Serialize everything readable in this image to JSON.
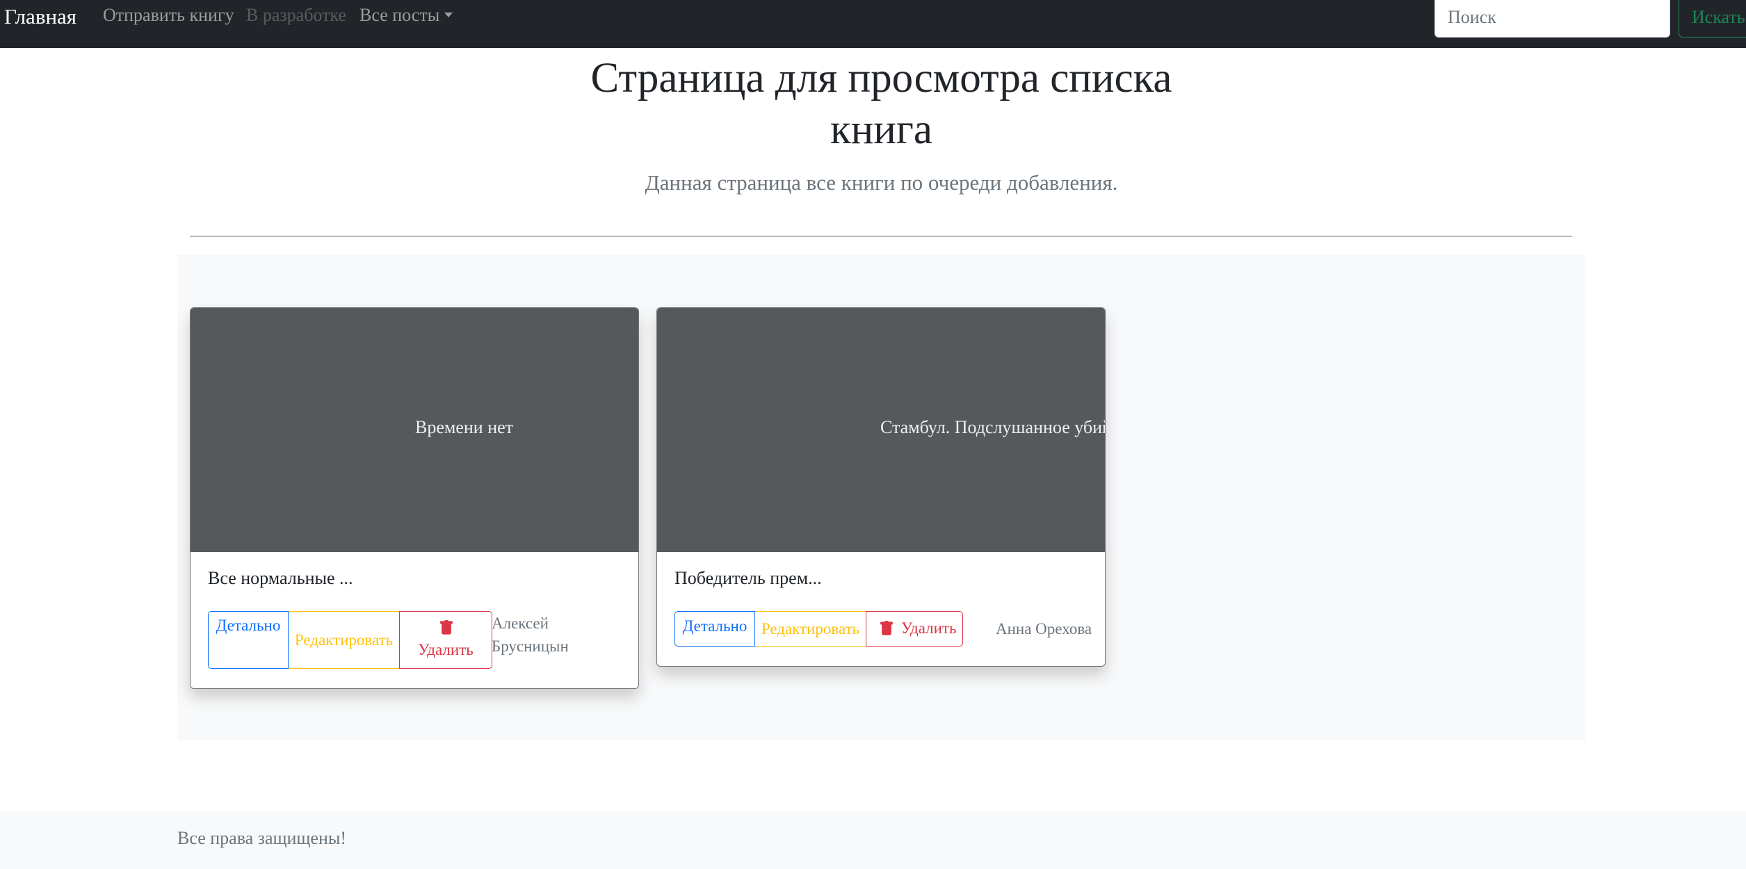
{
  "navbar": {
    "brand": "Главная",
    "links": {
      "submit": "Отправить книгу",
      "dev": "В разработке",
      "posts": "Все посты"
    },
    "search": {
      "placeholder": "Поиск",
      "button": "Искать"
    }
  },
  "header": {
    "title": "Страница для просмотра списка книга",
    "subtitle": "Данная страница все книги по очереди добавления."
  },
  "cards": [
    {
      "thumb_title": "Времени нет",
      "text": "Все нормальные ...",
      "buttons": {
        "detail": "Детально",
        "edit": "Редактировать",
        "delete": "Удалить"
      },
      "author": "Алексей Брусницын"
    },
    {
      "thumb_title": "Стамбул. Подслушанное убийство",
      "text": "Победитель прем...",
      "buttons": {
        "detail": "Детально",
        "edit": "Редактировать",
        "delete": "Удалить"
      },
      "author": "Анна Орехова"
    }
  ],
  "footer": {
    "text": "Все права защищены!"
  },
  "colors": {
    "navbar_bg": "#212529",
    "primary": "#0d6efd",
    "warning": "#ffc107",
    "danger": "#dc3545",
    "success": "#198754",
    "thumb_bg": "#55595c"
  },
  "icons": {
    "delete": "trash-icon",
    "dropdown": "caret-down-icon"
  }
}
